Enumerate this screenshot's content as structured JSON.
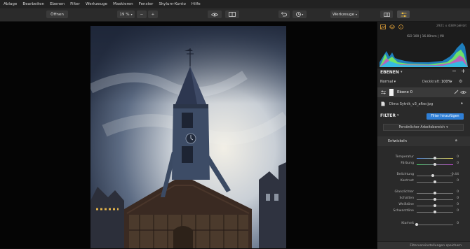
{
  "menu": [
    "Ablage",
    "Bearbeiten",
    "Ebenen",
    "Filter",
    "Werkzeuge",
    "Maskieren",
    "Fenster",
    "Skylum-Konto",
    "Hilfe"
  ],
  "toolbar": {
    "open_label": "Öffnen",
    "zoom_value": "19 %",
    "zoom_out": "−",
    "zoom_in": "+",
    "tools_label": "Werkzeuge"
  },
  "info": {
    "dimensions": "2921 x 4389 px",
    "bit_depth": "8-bit",
    "exif": "ISO 100  |  16.00mm  |  f/8"
  },
  "layers": {
    "title": "EBENEN",
    "blend_mode": "Normal",
    "opacity_label": "Deckkraft:",
    "opacity_value": "100%",
    "layer_name": "Ebene 0",
    "file_name": "Dima Sytnik_v3_after.jpg"
  },
  "filter": {
    "title": "FILTER",
    "add_button": "Filter hinzufügen",
    "workspace": "Persönlicher Arbeitsbereich",
    "develop_title": "Entwickeln",
    "save_presets": "Filtervoreinstellungen speichern"
  },
  "sliders": [
    {
      "label": "Temperatur",
      "value": "0",
      "level": 0.5
    },
    {
      "label": "Färbung",
      "value": "0",
      "level": 0.5
    },
    {
      "label": "Belichtung",
      "value": "-0.44",
      "level": 0.45
    },
    {
      "label": "Kontrast",
      "value": "0",
      "level": 0.5
    },
    {
      "label": "Glanzlichter",
      "value": "0",
      "level": 0.5
    },
    {
      "label": "Schatten",
      "value": "0",
      "level": 0.5
    },
    {
      "label": "Weißtöne",
      "value": "0",
      "level": 0.5
    },
    {
      "label": "Schwarztöne",
      "value": "0",
      "level": 0.5
    },
    {
      "label": "Klarheit",
      "value": "0",
      "level": 0.0
    }
  ],
  "colors": {
    "accent": "#2f7fd6",
    "panel": "#2a2a2a",
    "histogram_cyan": "#29c3e6",
    "histogram_green": "#7cf25a"
  }
}
